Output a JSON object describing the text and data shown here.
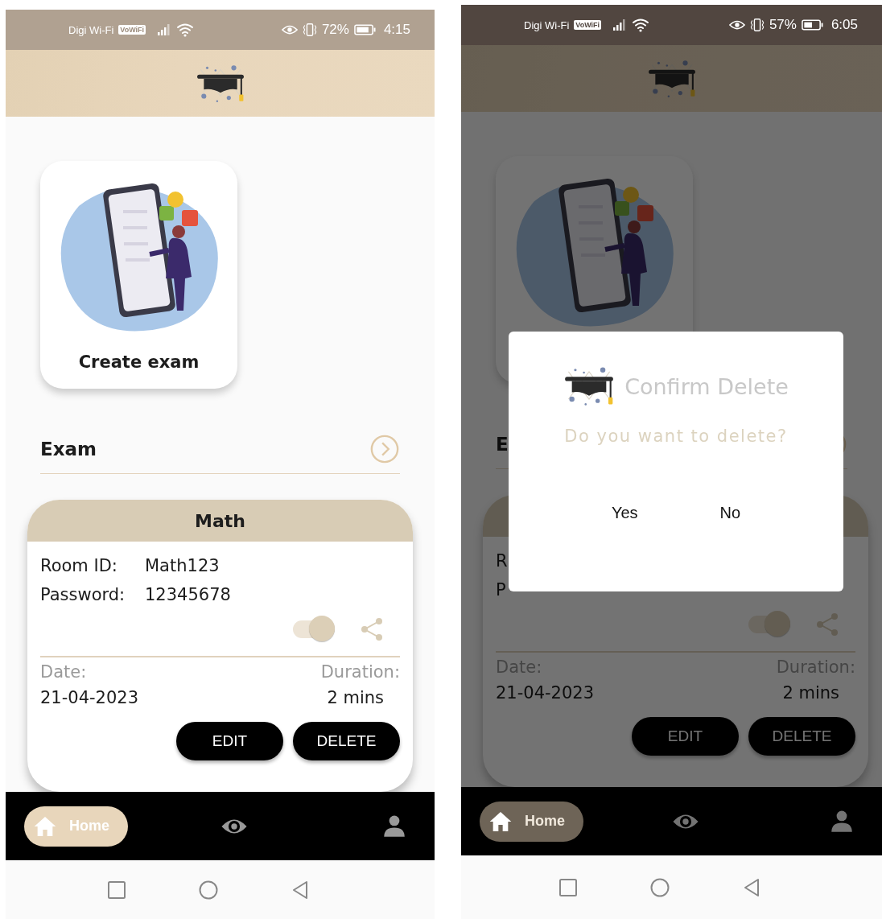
{
  "screens": [
    {
      "status_bar": {
        "carrier": "Digi Wi-Fi",
        "badge": "VoWiFi",
        "battery": "72%",
        "time": "4:15"
      },
      "create_card": {
        "label": "Create exam"
      },
      "section": {
        "title": "Exam"
      },
      "exam_card": {
        "title": "Math",
        "room_label": "Room ID:",
        "room_id": "Math123",
        "password_label": "Password:",
        "password": "12345678",
        "toggle_on": true,
        "date_label": "Date:",
        "date": "21-04-2023",
        "duration_label": "Duration:",
        "duration": "2 mins",
        "buttons": [
          "EDIT",
          "DELETE"
        ]
      },
      "nav": [
        {
          "kind": "home",
          "label": "Home",
          "selected": true
        },
        {
          "kind": "eye",
          "selected": false
        },
        {
          "kind": "person",
          "selected": false
        }
      ]
    },
    {
      "status_bar": {
        "carrier": "Digi Wi-Fi",
        "badge": "VoWiFi",
        "battery": "57%",
        "time": "6:05"
      },
      "section": {
        "title": "E"
      },
      "exam_card": {
        "room_label": "R",
        "password_label": "P",
        "toggle_on": true,
        "date_label": "Date:",
        "date": "21-04-2023",
        "duration_label": "Duration:",
        "duration": "2 mins",
        "buttons": [
          "EDIT",
          "DELETE"
        ]
      },
      "nav": [
        {
          "kind": "home",
          "label": "Home",
          "selected": true
        },
        {
          "kind": "eye",
          "selected": false
        },
        {
          "kind": "person",
          "selected": false
        }
      ],
      "dialog": {
        "title": "Confirm Delete",
        "message": "Do you want to delete?",
        "buttons": [
          "Yes",
          "No"
        ]
      }
    }
  ]
}
